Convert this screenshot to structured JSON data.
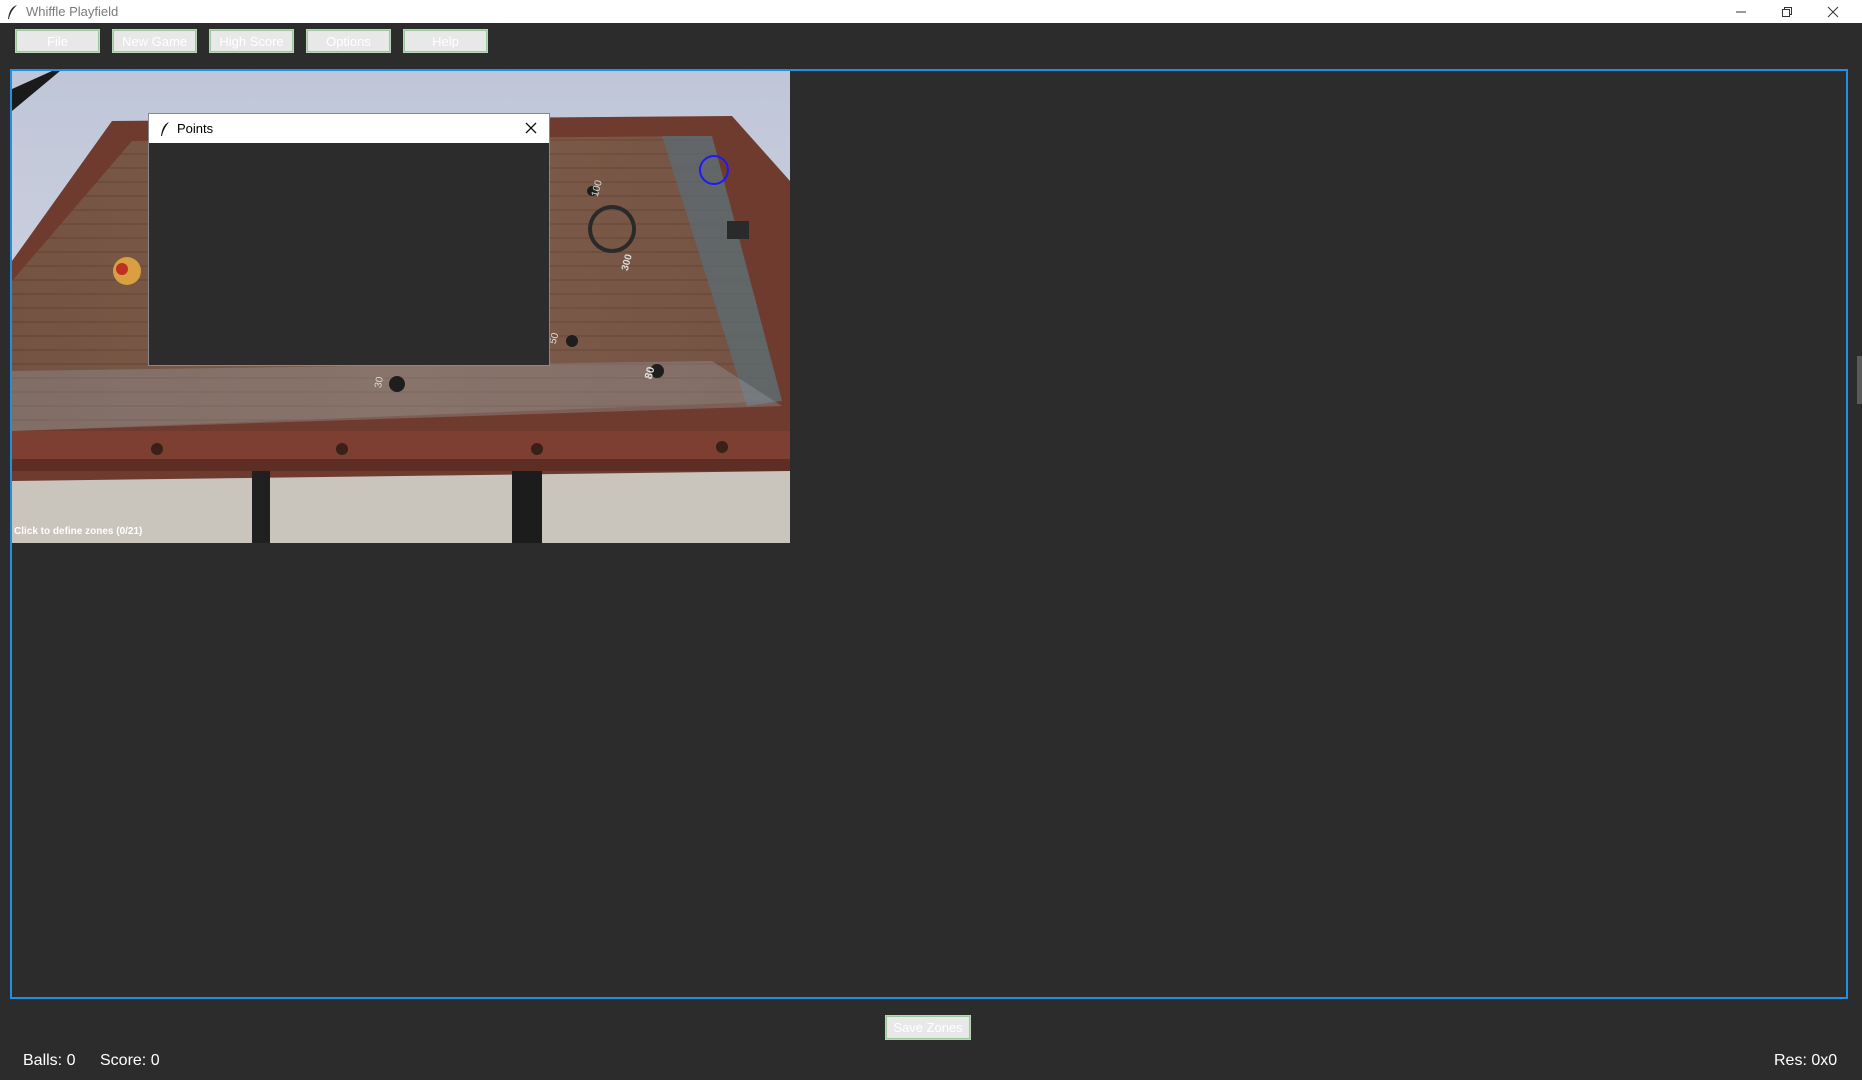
{
  "window": {
    "title": "Whiffle Playfield"
  },
  "toolbar": {
    "items": [
      {
        "label": "File"
      },
      {
        "label": "New Game"
      },
      {
        "label": "High Score"
      },
      {
        "label": "Options"
      },
      {
        "label": "Help"
      }
    ]
  },
  "playfield": {
    "overlay_text": "Click to define zones (0/21)",
    "field_labels": [
      "100",
      "300",
      "30",
      "50",
      "80"
    ]
  },
  "points_dialog": {
    "title": "Points"
  },
  "footer": {
    "save_label": "Save Zones"
  },
  "status": {
    "balls": "Balls: 0",
    "score": "Score: 0",
    "resolution": "Res: 0x0"
  },
  "colors": {
    "background": "#2c2c2c",
    "accent_border": "#1e90e6",
    "button_face": "#e8e8e8",
    "marker": "#1a1aff"
  }
}
